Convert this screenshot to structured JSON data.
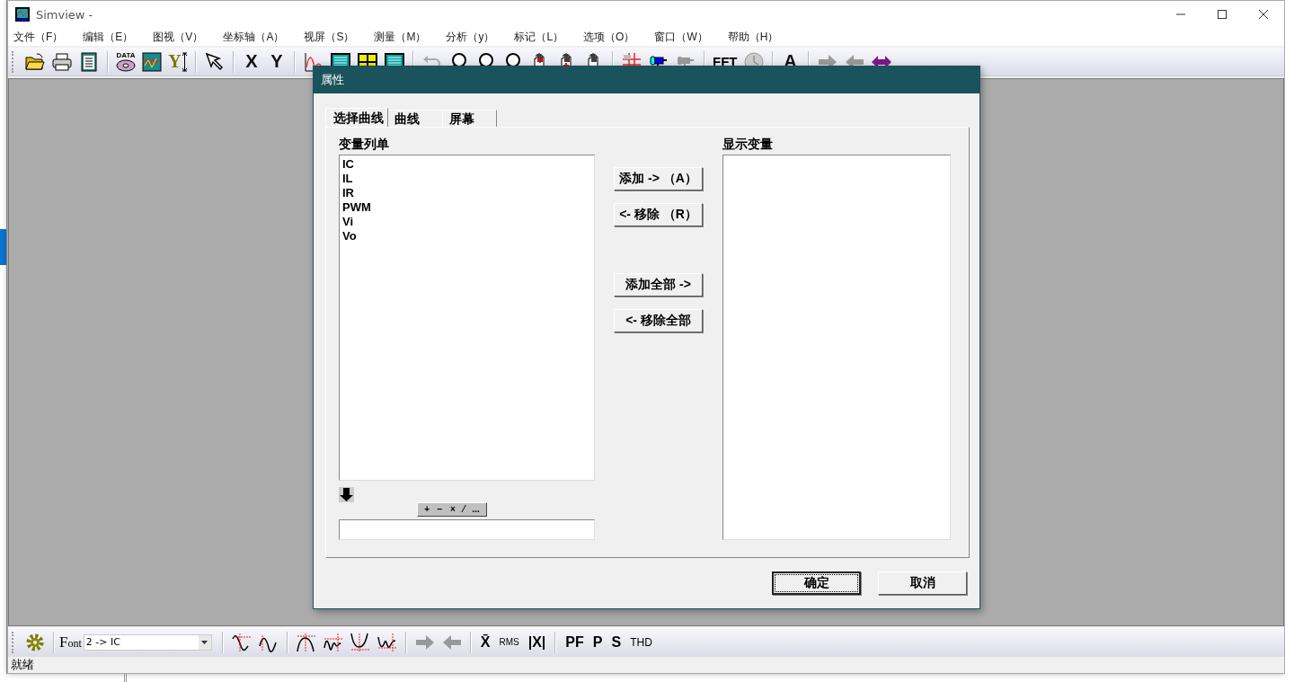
{
  "window": {
    "title": "Simview -"
  },
  "menu": [
    {
      "label": "文件（F）"
    },
    {
      "label": "编辑（E）"
    },
    {
      "label": "图视（V）"
    },
    {
      "label": "坐标轴（A）"
    },
    {
      "label": "视屏（S）"
    },
    {
      "label": "测量（M）"
    },
    {
      "label": "分析（y）"
    },
    {
      "label": "标记（L）"
    },
    {
      "label": "选项（O）"
    },
    {
      "label": "窗口（W）"
    },
    {
      "label": "帮助（H）"
    }
  ],
  "toolbar": {
    "texts": [
      "DATA",
      "Y",
      "X",
      "Y",
      "FFT",
      "A"
    ]
  },
  "dialog": {
    "title": "属性",
    "tabs": [
      {
        "label": "选择曲线",
        "selected": true
      },
      {
        "label": "曲线",
        "selected": false
      },
      {
        "label": "屏幕",
        "selected": false
      }
    ],
    "variable_list": {
      "label": "变量列单",
      "items": [
        "IC",
        "IL",
        "IR",
        "PWM",
        "Vi",
        "Vo"
      ]
    },
    "buttons": [
      "添加 -> （A）",
      "<- 移除 （R）",
      "添加全部 ->",
      "<- 移除全部"
    ],
    "operators": [
      "+",
      "−",
      "×",
      "⁄",
      "..."
    ],
    "display_list": {
      "label": "显示变量"
    },
    "ok": "确定",
    "cancel": "取消"
  },
  "bottom_toolbar": {
    "font_label": "Font",
    "trace_select": "2 -> IC",
    "texts": [
      "X̄",
      "RMS",
      "|X|",
      "PF",
      "P",
      "S",
      "THD"
    ]
  },
  "status_bar": {
    "text": "就绪"
  }
}
